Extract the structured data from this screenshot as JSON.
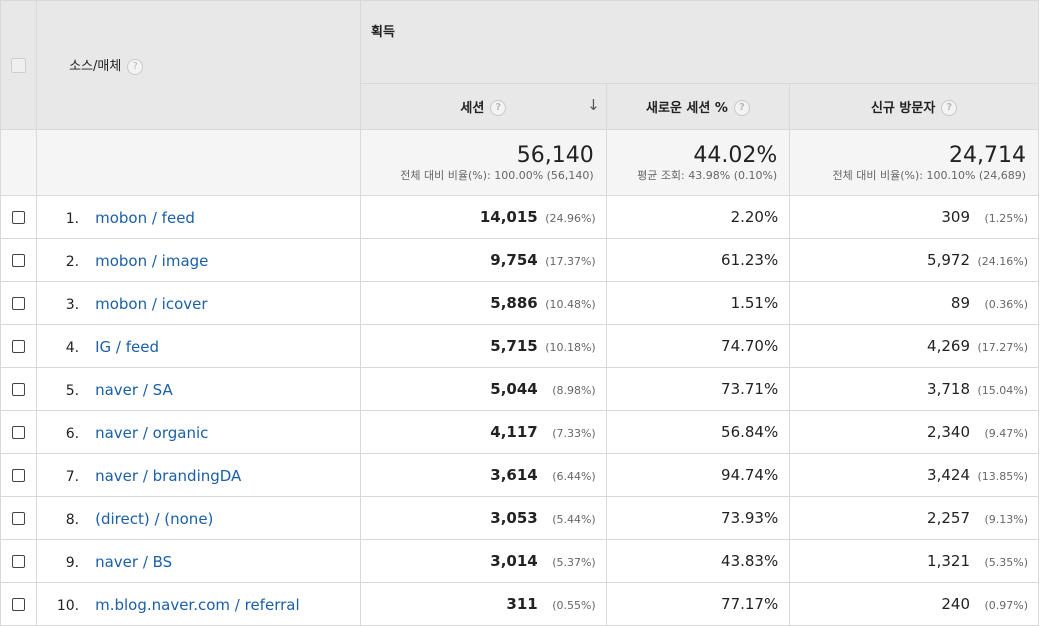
{
  "header": {
    "source_medium": "소스/매체",
    "acquisition": "획득",
    "sessions": "세션",
    "new_session_pct": "새로운 세션 %",
    "new_visitors": "신규 방문자",
    "help": "?",
    "sort_arrow": "↓"
  },
  "summary": {
    "sessions": "56,140",
    "sessions_note": "전체 대비 비율(%): 100.00% (56,140)",
    "new_session_pct": "44.02%",
    "new_session_pct_note": "평균 조회: 43.98% (0.10%)",
    "new_visitors": "24,714",
    "new_visitors_note": "전체 대비 비율(%): 100.10% (24,689)"
  },
  "rows": [
    {
      "index": "1.",
      "source": "mobon / feed",
      "sessions": "14,015",
      "sessions_pct": "(24.96%)",
      "new_pct": "2.20%",
      "visitors": "309",
      "visitors_pct": "(1.25%)"
    },
    {
      "index": "2.",
      "source": "mobon / image",
      "sessions": "9,754",
      "sessions_pct": "(17.37%)",
      "new_pct": "61.23%",
      "visitors": "5,972",
      "visitors_pct": "(24.16%)"
    },
    {
      "index": "3.",
      "source": "mobon / icover",
      "sessions": "5,886",
      "sessions_pct": "(10.48%)",
      "new_pct": "1.51%",
      "visitors": "89",
      "visitors_pct": "(0.36%)"
    },
    {
      "index": "4.",
      "source": "IG / feed",
      "sessions": "5,715",
      "sessions_pct": "(10.18%)",
      "new_pct": "74.70%",
      "visitors": "4,269",
      "visitors_pct": "(17.27%)"
    },
    {
      "index": "5.",
      "source": "naver / SA",
      "sessions": "5,044",
      "sessions_pct": "(8.98%)",
      "new_pct": "73.71%",
      "visitors": "3,718",
      "visitors_pct": "(15.04%)"
    },
    {
      "index": "6.",
      "source": "naver / organic",
      "sessions": "4,117",
      "sessions_pct": "(7.33%)",
      "new_pct": "56.84%",
      "visitors": "2,340",
      "visitors_pct": "(9.47%)"
    },
    {
      "index": "7.",
      "source": "naver / brandingDA",
      "sessions": "3,614",
      "sessions_pct": "(6.44%)",
      "new_pct": "94.74%",
      "visitors": "3,424",
      "visitors_pct": "(13.85%)"
    },
    {
      "index": "8.",
      "source": "(direct) / (none)",
      "sessions": "3,053",
      "sessions_pct": "(5.44%)",
      "new_pct": "73.93%",
      "visitors": "2,257",
      "visitors_pct": "(9.13%)"
    },
    {
      "index": "9.",
      "source": "naver / BS",
      "sessions": "3,014",
      "sessions_pct": "(5.37%)",
      "new_pct": "43.83%",
      "visitors": "1,321",
      "visitors_pct": "(5.35%)"
    },
    {
      "index": "10.",
      "source": "m.blog.naver.com / referral",
      "sessions": "311",
      "sessions_pct": "(0.55%)",
      "new_pct": "77.17%",
      "visitors": "240",
      "visitors_pct": "(0.97%)"
    }
  ],
  "colors": {
    "link": "#1a5fa8",
    "header_bg": "#e8e8e8",
    "summary_bg": "#f5f5f5",
    "border": "#d9d9d9"
  }
}
